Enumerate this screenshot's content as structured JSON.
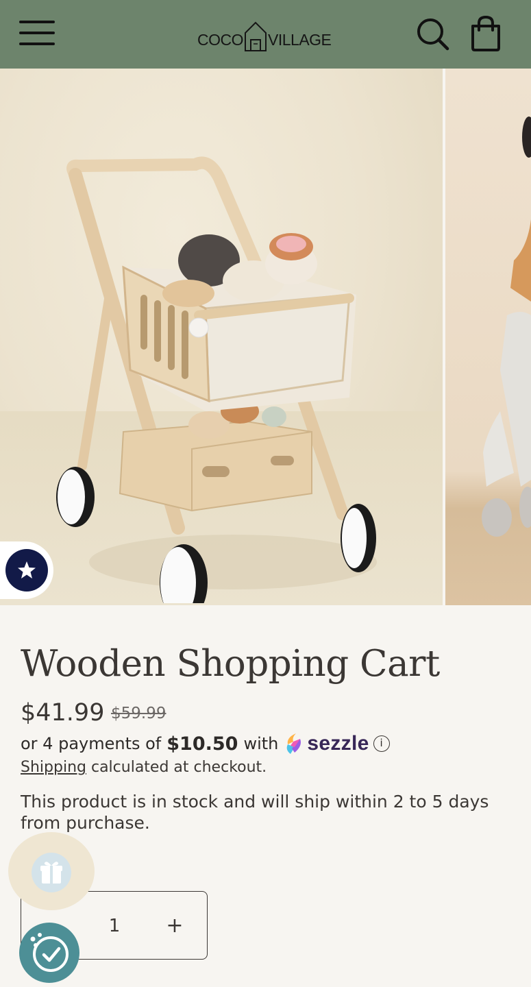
{
  "header": {
    "logo_left": "COCO",
    "logo_right": "VILLAGE"
  },
  "product": {
    "title": "Wooden Shopping Cart",
    "price": "$41.99",
    "compare_price": "$59.99",
    "installments_prefix": "or 4 payments of",
    "installment_amount": "$10.50",
    "installments_suffix": "with",
    "sezzle_label": "sezzle",
    "info_glyph": "i",
    "shipping_link": "Shipping",
    "shipping_rest": " calculated at checkout.",
    "stock_note": "This product is in stock and will ship within 2 to 5 days from purchase."
  },
  "quantity": {
    "minus": "−",
    "value": "1",
    "plus": "+"
  },
  "icons": {
    "menu": "menu-icon",
    "search": "search-icon",
    "bag": "bag-icon",
    "review": "star-icon",
    "gift": "gift-icon",
    "rewards": "rewards-check-icon"
  },
  "colors": {
    "header_bg": "#6d846c",
    "page_bg": "#f7f5f1",
    "review_badge": "#121a48",
    "sezzle_brand": "#382757",
    "rewards_widget": "#4d8f96",
    "gift_widget": "#efe6d2"
  }
}
